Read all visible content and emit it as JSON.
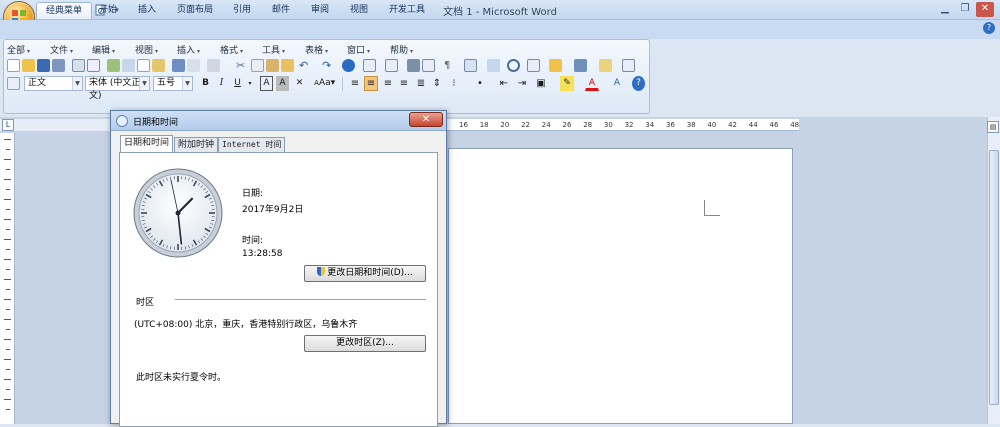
{
  "window": {
    "title": "文档 1 - Microsoft Word"
  },
  "ribbon_tabs": [
    {
      "label": "经典菜单",
      "active": true
    },
    {
      "label": "开始"
    },
    {
      "label": "插入"
    },
    {
      "label": "页面布局"
    },
    {
      "label": "引用"
    },
    {
      "label": "邮件"
    },
    {
      "label": "审阅"
    },
    {
      "label": "视图"
    },
    {
      "label": "开发工具"
    }
  ],
  "menus": [
    "全部",
    "文件",
    "编辑",
    "视图",
    "插入",
    "格式",
    "工具",
    "表格",
    "窗口",
    "帮助"
  ],
  "format": {
    "style": "正文",
    "font": "宋体 (中文正文)",
    "size": "五号"
  },
  "ruler_numbers": [
    "16",
    "18",
    "20",
    "22",
    "24",
    "26",
    "28",
    "30",
    "32",
    "34",
    "36",
    "38",
    "40",
    "42",
    "44",
    "46",
    "48"
  ],
  "dialog": {
    "title": "日期和时间",
    "tabs": [
      {
        "label": "日期和时间",
        "active": true
      },
      {
        "label": "附加时钟"
      },
      {
        "label": "Internet 时间"
      }
    ],
    "date_label": "日期:",
    "date_value": "2017年9月2日",
    "time_label": "时间:",
    "time_value": "13:28:58",
    "change_datetime_button": "更改日期和时间(D)...",
    "timezone_section": "时区",
    "timezone_value": "(UTC+08:00) 北京，重庆，香港特别行政区，乌鲁木齐",
    "change_timezone_button": "更改时区(Z)...",
    "dst_note": "此时区未实行夏令时。",
    "clock": {
      "hours": 13,
      "minutes": 28,
      "seconds": 58
    }
  }
}
